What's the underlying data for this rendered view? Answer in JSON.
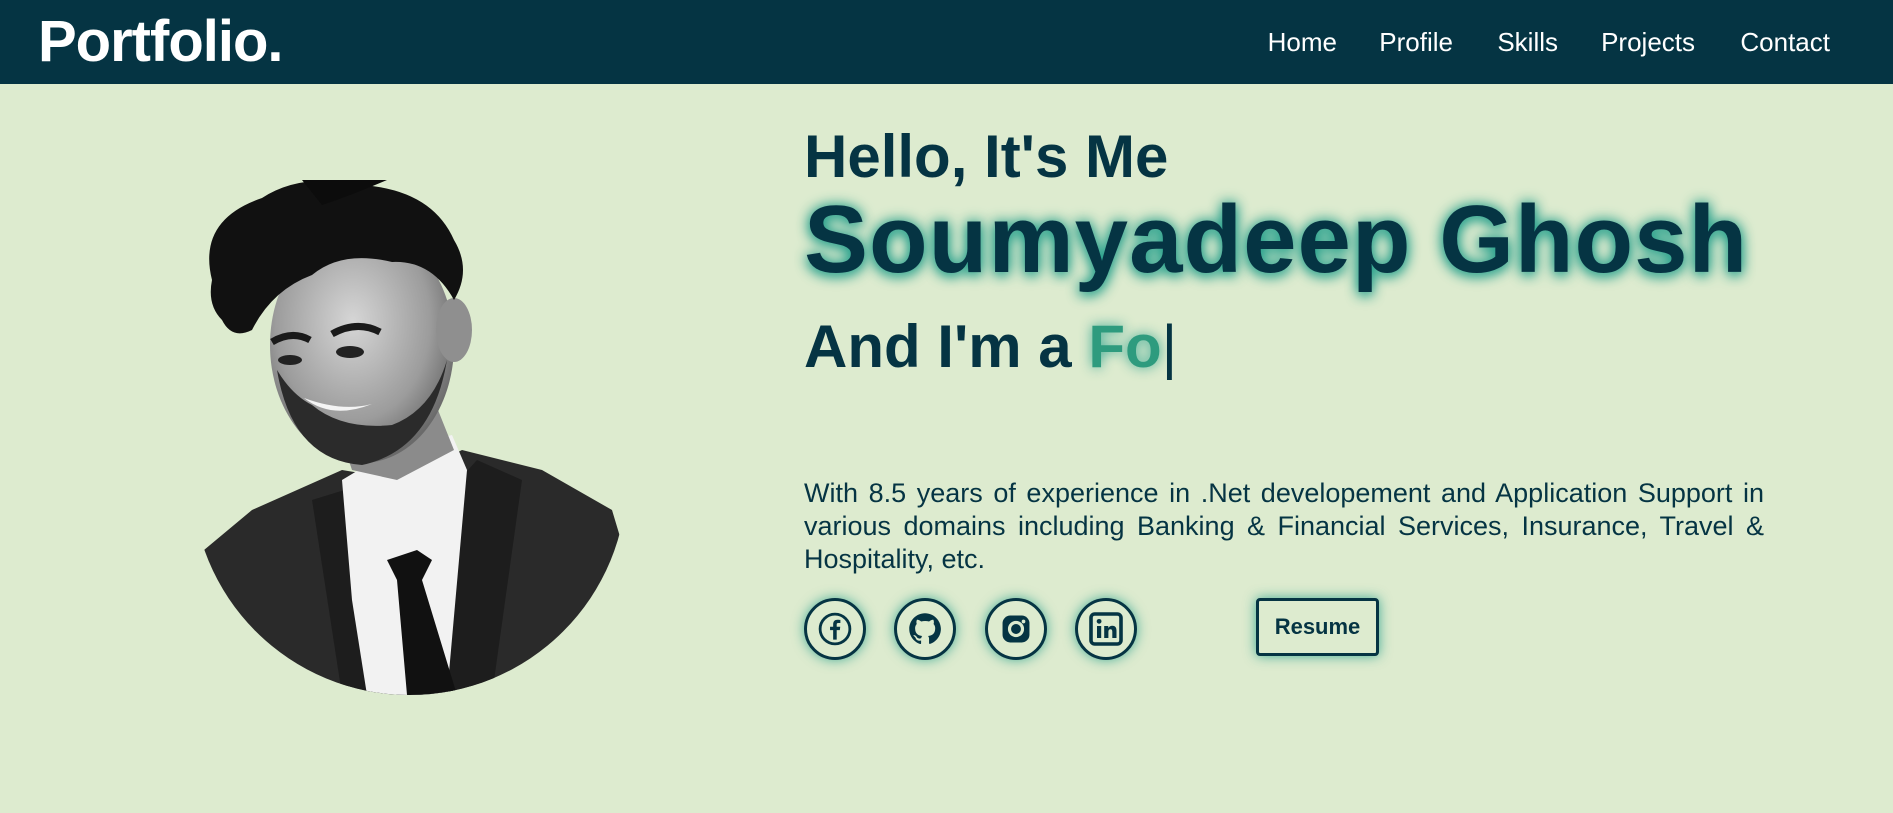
{
  "header": {
    "logo": "Portfolio.",
    "nav": [
      "Home",
      "Profile",
      "Skills",
      "Projects",
      "Contact"
    ]
  },
  "hero": {
    "greeting": "Hello, It's Me",
    "name": "Soumyadeep Ghosh",
    "role_prefix": "And I'm a",
    "role_typed": "Fo",
    "cursor": "|",
    "description": "With 8.5 years of experience in .Net developement and Application Support in various domains including Banking & Financial Services, Insurance, Travel & Hospitality, etc.",
    "resume_label": "Resume"
  },
  "socials": [
    "facebook-icon",
    "github-icon",
    "instagram-icon",
    "linkedin-icon"
  ],
  "colors": {
    "primary": "#053443",
    "background": "#ddebcf",
    "accent": "#2e9b7e",
    "glow": "#1a9b87",
    "nav_text": "#ffffff"
  }
}
